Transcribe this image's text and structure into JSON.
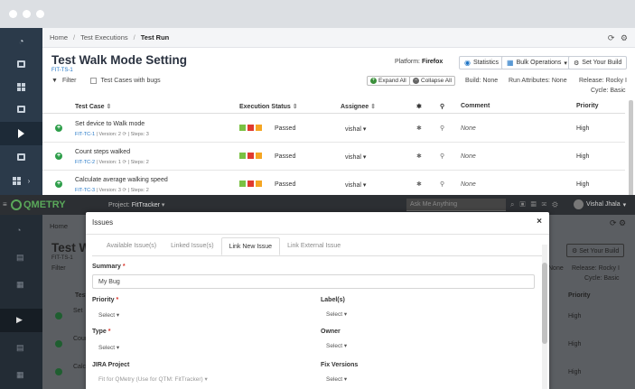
{
  "breadcrumb": {
    "home": "Home",
    "executions": "Test Executions",
    "current": "Test Run"
  },
  "page": {
    "title": "Test Walk Mode Setting",
    "key": "FIT-TS-1"
  },
  "platform": {
    "label": "Platform:",
    "value": "Firefox"
  },
  "toolbar": {
    "statistics": "Statistics",
    "bulk_operations": "Bulk Operations",
    "set_build": "Set Your Build"
  },
  "filter": {
    "label": "Filter",
    "bugs_checkbox": "Test Cases with bugs"
  },
  "controls": {
    "expand_all": "Expand All",
    "collapse_all": "Collapse All",
    "build": "Build: None",
    "run_attributes": "Run Attributes: None",
    "release": "Release: Rocky I",
    "cycle": "Cycle: Basic"
  },
  "table": {
    "headers": {
      "test_case": "Test Case",
      "execution_status": "Execution Status",
      "assignee": "Assignee",
      "comment": "Comment",
      "priority": "Priority"
    },
    "rows": [
      {
        "name": "Set device to Walk mode",
        "key": "FIT-TC-1",
        "version": "Version: 2",
        "steps": "Steps: 3",
        "status": "Passed",
        "assignee": "vishal",
        "comment": "None",
        "priority": "High"
      },
      {
        "name": "Count steps walked",
        "key": "FIT-TC-2",
        "version": "Version: 1",
        "steps": "Steps: 2",
        "status": "Passed",
        "assignee": "vishal",
        "comment": "None",
        "priority": "High"
      },
      {
        "name": "Calculate average walking speed",
        "key": "FIT-TC-3",
        "version": "Version: 3",
        "steps": "Steps: 2",
        "status": "Passed",
        "assignee": "vishal",
        "comment": "None",
        "priority": "High"
      }
    ]
  },
  "app2": {
    "logo": "QMETRY",
    "project_label": "Project:",
    "project_value": "FitTracker",
    "search_placeholder": "Ask Me Anything",
    "user": "Vishal Jhala",
    "home": "Home",
    "title_partial": "Test W",
    "key_partial": "FIT-TS-1",
    "filter": "Filter",
    "test_partial": "Test",
    "set_build": "Set Your Build",
    "release": "Release: Rocky I",
    "cycle": "Cycle: Basic",
    "none_partial": "None",
    "priority": "Priority",
    "high": [
      "High",
      "High",
      "High"
    ],
    "set_partial": "Set",
    "coun_partial": "Coun",
    "calc_partial": "Calc"
  },
  "modal": {
    "title": "Issues",
    "tabs": [
      "Available Issue(s)",
      "Linked Issue(s)",
      "Link New Issue",
      "Link External Issue"
    ],
    "summary_label": "Summary",
    "summary_value": "My Bug",
    "priority_label": "Priority",
    "priority_value": "Select",
    "labels_label": "Label(s)",
    "labels_value": "Select",
    "type_label": "Type",
    "type_value": "Select",
    "owner_label": "Owner",
    "owner_value": "Select",
    "jira_label": "JIRA Project",
    "jira_value": "Fit for QMetry (Use for QTM: FitTracker)",
    "fixversions_label": "Fix Versions",
    "fixversions_value": "Select"
  },
  "colors": {
    "accent": "#1e74c5",
    "passed_green": "#7ac143",
    "red": "#e03a2f",
    "amber": "#f5a623",
    "sidebar": "#2b3a4a"
  }
}
